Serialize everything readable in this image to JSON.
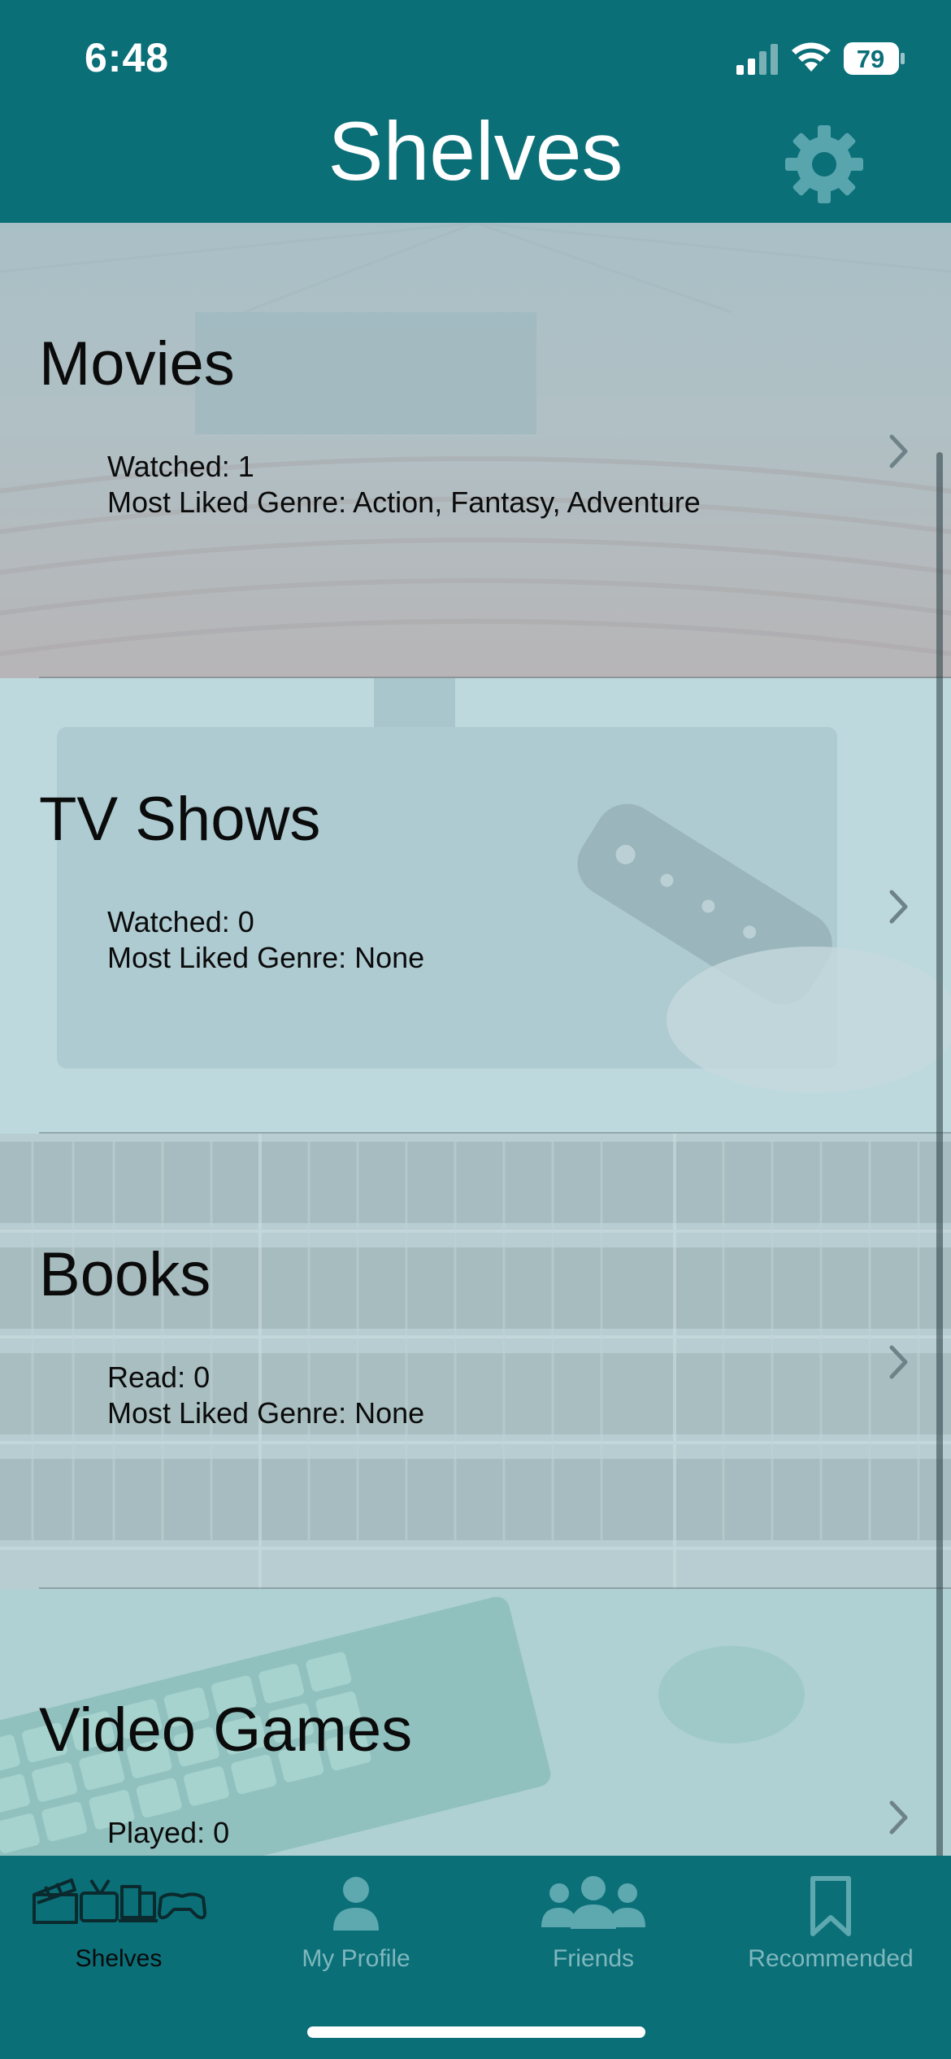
{
  "status_bar": {
    "time": "6:48",
    "battery": "79",
    "icons": [
      "signal-icon",
      "wifi-icon",
      "battery-icon"
    ]
  },
  "header": {
    "title": "Shelves",
    "settings_icon": "gear-icon"
  },
  "colors": {
    "primary": "#0b6f78",
    "tab_inactive": "#7fb7bd",
    "tab_active": "#0a0a0a",
    "text": "#0b0b0b"
  },
  "shelves": [
    {
      "title": "Movies",
      "stat1": "Watched: 1",
      "stat2": "Most Liked Genre: Action, Fantasy, Adventure"
    },
    {
      "title": "TV Shows",
      "stat1": "Watched: 0",
      "stat2": "Most Liked Genre: None"
    },
    {
      "title": "Books",
      "stat1": "Read: 0",
      "stat2": "Most Liked Genre: None"
    },
    {
      "title": "Video Games",
      "stat1": "Played: 0",
      "stat2": ""
    }
  ],
  "tabs": [
    {
      "label": "Shelves",
      "icon": "shelves-icon",
      "active": true
    },
    {
      "label": "My Profile",
      "icon": "person-icon",
      "active": false
    },
    {
      "label": "Friends",
      "icon": "friends-icon",
      "active": false
    },
    {
      "label": "Recommended",
      "icon": "bookmark-icon",
      "active": false
    }
  ]
}
